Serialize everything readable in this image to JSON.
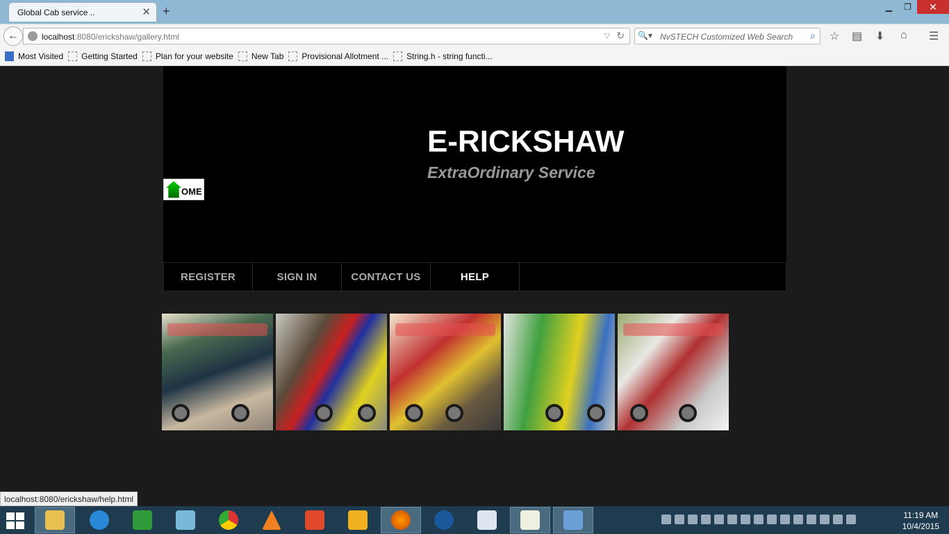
{
  "browser": {
    "tab_title": "Global Cab service ..",
    "new_tab_symbol": "+",
    "url_host": "localhost",
    "url_rest": ":8080/erickshaw/gallery.html",
    "search_placeholder": "NvSTECH Customized Web Search",
    "bookmarks": [
      "Most Visited",
      "Getting Started",
      "Plan for your website",
      "New Tab",
      "Provisional Allotment ...",
      "String.h - string functi..."
    ]
  },
  "header": {
    "title": "E-RICKSHAW",
    "tagline": "ExtraOrdinary Service",
    "home_label": "OME"
  },
  "menu": [
    "REGISTER",
    "SIGN IN",
    "CONTACT US",
    "HELP"
  ],
  "status_bar": {
    "link_url": "localhost:8080/erickshaw/help.html"
  },
  "taskbar": {
    "time": "11:19 AM",
    "date": "10/4/2015"
  },
  "icons": {
    "app": [
      "file-explorer-icon",
      "internet-explorer-icon",
      "store-icon",
      "notepad-icon",
      "chrome-icon",
      "vlc-icon",
      "music-icon",
      "media-player-icon",
      "firefox-icon",
      "speed-icon",
      "word-icon",
      "document-icon",
      "virtualbox-icon"
    ]
  }
}
